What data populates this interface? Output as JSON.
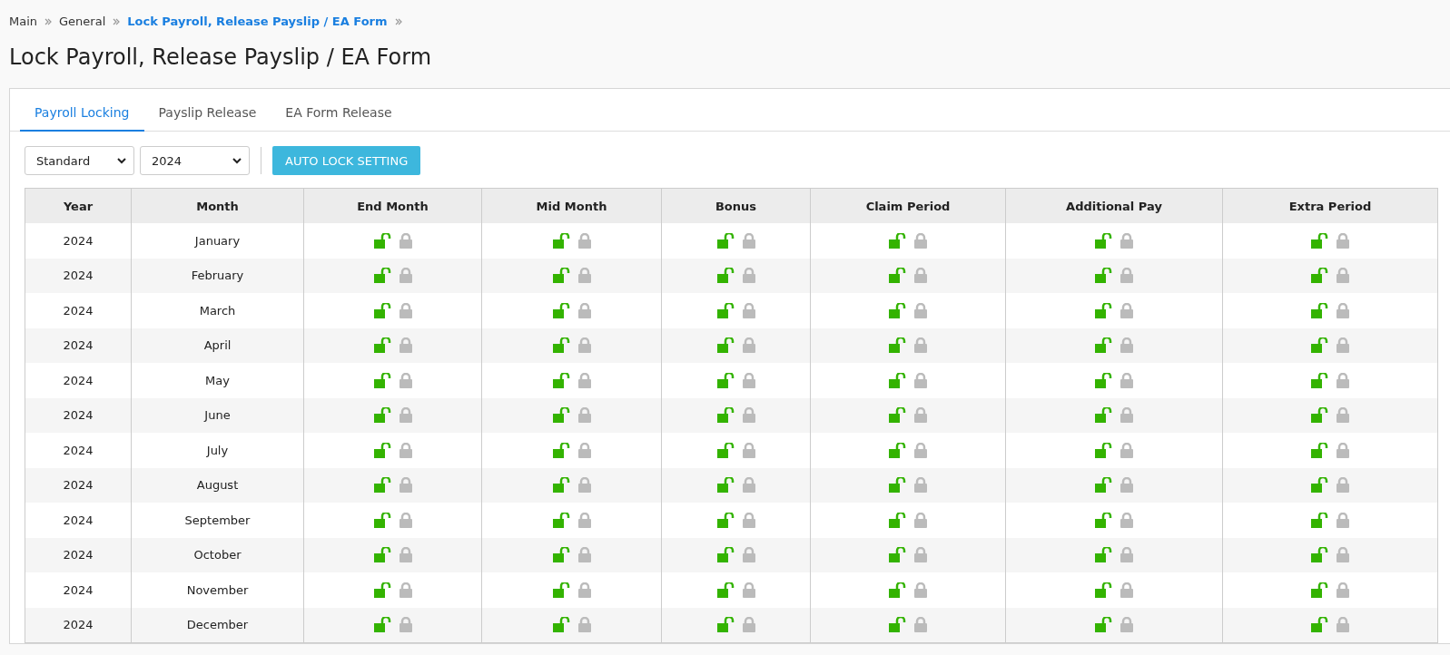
{
  "breadcrumb": [
    {
      "label": "Main",
      "current": false
    },
    {
      "label": "General",
      "current": false
    },
    {
      "label": "Lock Payroll, Release Payslip / EA Form",
      "current": true
    }
  ],
  "title": "Lock Payroll, Release Payslip / EA Form",
  "tabs": [
    {
      "label": "Payroll Locking",
      "selected": true
    },
    {
      "label": "Payslip Release",
      "selected": false
    },
    {
      "label": "EA Form Release",
      "selected": false
    }
  ],
  "filters": [
    {
      "value": "Standard"
    },
    {
      "value": "2024"
    }
  ],
  "auto_lock_button": "AUTO LOCK SETTING",
  "table": {
    "columns": [
      "Year",
      "Month",
      "End Month",
      "Mid Month",
      "Bonus",
      "Claim Period",
      "Additional Pay",
      "Extra Period"
    ],
    "rows": [
      {
        "year": "2024",
        "month": "January",
        "locks": [
          {
            "locked": false
          },
          {
            "locked": false
          },
          {
            "locked": false
          },
          {
            "locked": false
          },
          {
            "locked": false
          },
          {
            "locked": false
          }
        ]
      },
      {
        "year": "2024",
        "month": "February",
        "locks": [
          {
            "locked": false
          },
          {
            "locked": false
          },
          {
            "locked": false
          },
          {
            "locked": false
          },
          {
            "locked": false
          },
          {
            "locked": false
          }
        ]
      },
      {
        "year": "2024",
        "month": "March",
        "locks": [
          {
            "locked": false
          },
          {
            "locked": false
          },
          {
            "locked": false
          },
          {
            "locked": false
          },
          {
            "locked": false
          },
          {
            "locked": false
          }
        ]
      },
      {
        "year": "2024",
        "month": "April",
        "locks": [
          {
            "locked": false
          },
          {
            "locked": false
          },
          {
            "locked": false
          },
          {
            "locked": false
          },
          {
            "locked": false
          },
          {
            "locked": false
          }
        ]
      },
      {
        "year": "2024",
        "month": "May",
        "locks": [
          {
            "locked": false
          },
          {
            "locked": false
          },
          {
            "locked": false
          },
          {
            "locked": false
          },
          {
            "locked": false
          },
          {
            "locked": false
          }
        ]
      },
      {
        "year": "2024",
        "month": "June",
        "locks": [
          {
            "locked": false
          },
          {
            "locked": false
          },
          {
            "locked": false
          },
          {
            "locked": false
          },
          {
            "locked": false
          },
          {
            "locked": false
          }
        ]
      },
      {
        "year": "2024",
        "month": "July",
        "locks": [
          {
            "locked": false
          },
          {
            "locked": false
          },
          {
            "locked": false
          },
          {
            "locked": false
          },
          {
            "locked": false
          },
          {
            "locked": false
          }
        ]
      },
      {
        "year": "2024",
        "month": "August",
        "locks": [
          {
            "locked": false
          },
          {
            "locked": false
          },
          {
            "locked": false
          },
          {
            "locked": false
          },
          {
            "locked": false
          },
          {
            "locked": false
          }
        ]
      },
      {
        "year": "2024",
        "month": "September",
        "locks": [
          {
            "locked": false
          },
          {
            "locked": false
          },
          {
            "locked": false
          },
          {
            "locked": false
          },
          {
            "locked": false
          },
          {
            "locked": false
          }
        ]
      },
      {
        "year": "2024",
        "month": "October",
        "locks": [
          {
            "locked": false
          },
          {
            "locked": false
          },
          {
            "locked": false
          },
          {
            "locked": false
          },
          {
            "locked": false
          },
          {
            "locked": false
          }
        ]
      },
      {
        "year": "2024",
        "month": "November",
        "locks": [
          {
            "locked": false
          },
          {
            "locked": false
          },
          {
            "locked": false
          },
          {
            "locked": false
          },
          {
            "locked": false
          },
          {
            "locked": false
          }
        ]
      },
      {
        "year": "2024",
        "month": "December",
        "locks": [
          {
            "locked": false
          },
          {
            "locked": false
          },
          {
            "locked": false
          },
          {
            "locked": false
          },
          {
            "locked": false
          },
          {
            "locked": false
          }
        ]
      }
    ]
  }
}
